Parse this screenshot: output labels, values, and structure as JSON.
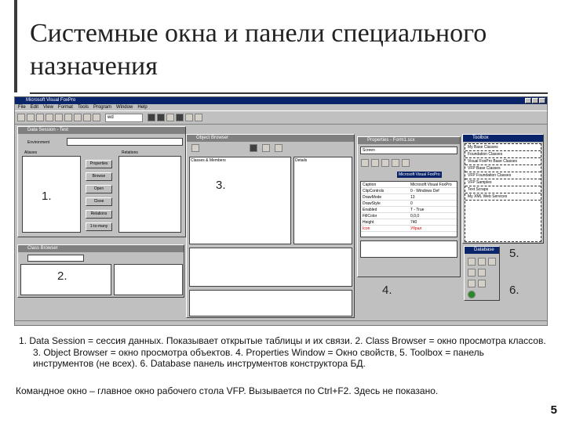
{
  "slide": {
    "title": "Системные окна и панели специального назначения",
    "caption": "1. Data Session = сессия данных. Показывает открытые таблицы и их связи. 2. Class Browser = окно просмотра классов. 3. Object Browser = окно просмотра объектов. 4. Properties Window = Окно свойств, 5. Toolbox = панель инструментов (не всех). 6. Database панель инструментов конструктора БД.",
    "caption2": "Командное окно – главное окно рабочего стола VFP. Вызывается по Ctrl+F2. Здесь не показано.",
    "page_number": "5"
  },
  "app": {
    "title": "Microsoft Visual FoxPro",
    "menu": [
      "File",
      "Edit",
      "View",
      "Format",
      "Tools",
      "Program",
      "Window",
      "Help"
    ],
    "toolbar_field": "wd"
  },
  "callouts": [
    "1.",
    "2.",
    "3.",
    "4.",
    "5.",
    "6."
  ],
  "data_session": {
    "title": "Data Session - Test",
    "env_label": "Environment",
    "alias_label": "Aliases",
    "relations_label": "Relations",
    "buttons": [
      "Properties",
      "Browse",
      "Open",
      "Close",
      "Relations",
      "1-to-many"
    ]
  },
  "class_browser": {
    "title": "Class Browser"
  },
  "object_browser": {
    "title": "Object Browser",
    "left_header": "Classes & Members",
    "right_header": "Details"
  },
  "properties": {
    "title": "Properties - Form1.scx",
    "object_combo": "Screen",
    "selected_value": "Microsoft Visual FoxPro",
    "rows": [
      [
        "Caption",
        "Microsoft Visual FoxPro"
      ],
      [
        "ClipControls",
        "0 - Windows Def"
      ],
      [
        "DrawMode",
        "13"
      ],
      [
        "DrawStyle",
        "0"
      ],
      [
        "Enabled",
        "T - True"
      ],
      [
        "FillColor",
        "0,0,0"
      ],
      [
        "Height",
        "740"
      ],
      [
        "Icon",
        "Убрал"
      ]
    ]
  },
  "toolbox": {
    "title": "Toolbox",
    "items": [
      "My Base Classes",
      "Foundation Classes",
      "Visual FoxPro Base Classes",
      "VFP Base Classes",
      "VFP Foundation Classes",
      "VFP Samples",
      "Text Scraps",
      "My XML Web Services"
    ]
  },
  "database_toolbar": {
    "title": "Database"
  }
}
